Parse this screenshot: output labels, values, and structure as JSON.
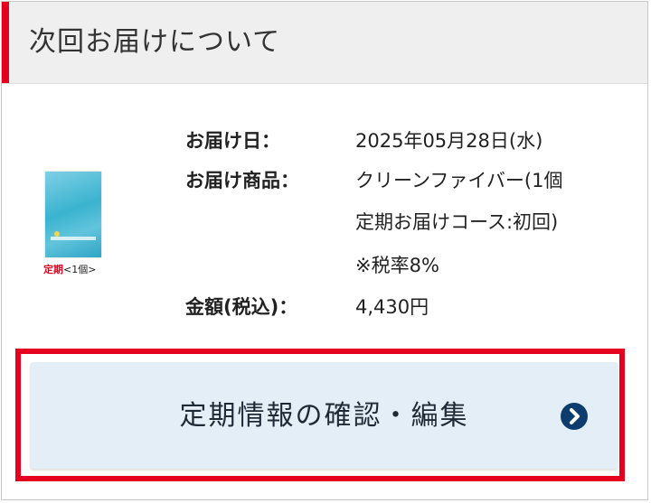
{
  "section": {
    "title": "次回お届けについて"
  },
  "product": {
    "caption_plan": "定期",
    "caption_qty": "<1個>"
  },
  "details": {
    "date_label": "お届け日：",
    "date_value": "2025年05月28日(水)",
    "item_label": "お届け商品：",
    "item_value_line1": "クリーンファイバー(1個",
    "item_value_line2": "定期お届けコース:初回)",
    "item_value_line3": "※税率8%",
    "price_label": "金額(税込)：",
    "price_value": "4,430円"
  },
  "action": {
    "label": "定期情報の確認・編集",
    "icon": "chevron-right-circle-icon"
  },
  "colors": {
    "accent_red": "#e4001e",
    "button_bg": "#e4eef6",
    "icon_navy": "#0d3d6e",
    "header_bg": "#efefef"
  }
}
